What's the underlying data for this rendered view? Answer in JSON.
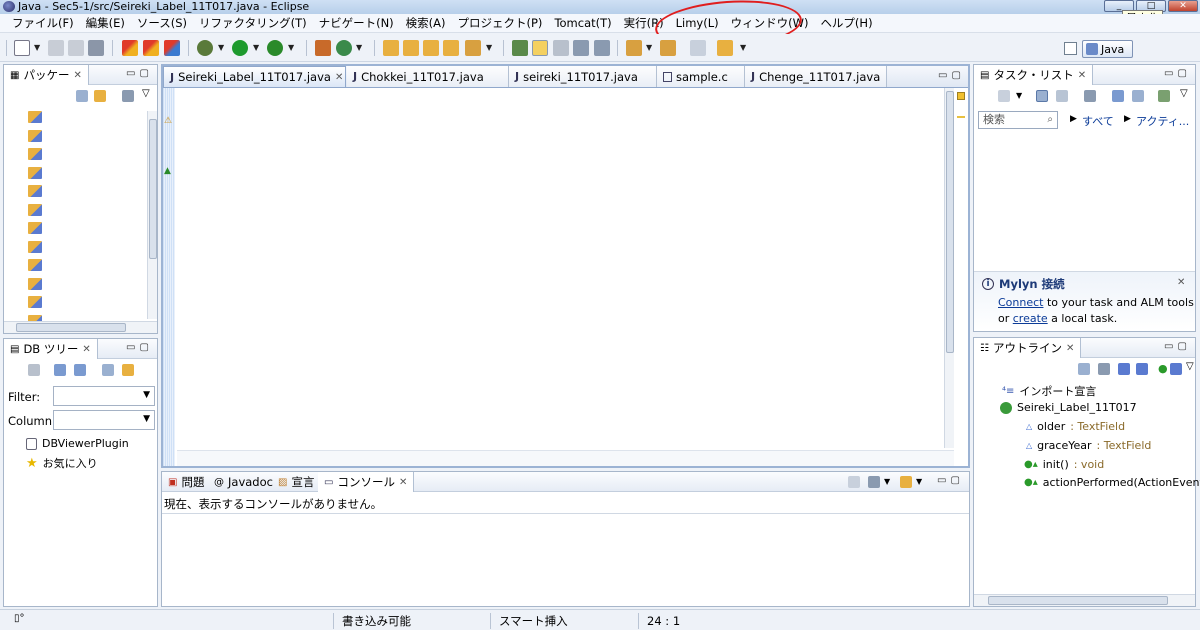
{
  "window": {
    "title": "Java - Sec5-1/src/Seireki_Label_11T017.java - Eclipse",
    "tooltip": "最小化"
  },
  "menu": [
    "ファイル(F)",
    "編集(E)",
    "ソース(S)",
    "リファクタリング(T)",
    "ナビゲート(N)",
    "検索(A)",
    "プロジェクト(P)",
    "Tomcat(T)",
    "実行(R)",
    "Limy(L)",
    "ウィンドウ(W)",
    "ヘルプ(H)"
  ],
  "perspective": {
    "label": "Java"
  },
  "package_explorer": {
    "title": "パッケー"
  },
  "db_tree": {
    "title": "DB ツリー",
    "filter_label": "Filter:",
    "column_label": "Column:",
    "items": [
      "DBViewerPlugin",
      "お気に入り"
    ]
  },
  "editor": {
    "tabs": [
      "Seireki_Label_11T017.java",
      "Chokkei_11T017.java",
      "seireki_11T017.java",
      "sample.c",
      "Chenge_11T017.java"
    ]
  },
  "console_panel": {
    "tabs": [
      "問題",
      "Javadoc",
      "宣言",
      "コンソール"
    ],
    "message": "現在、表示するコンソールがありません。"
  },
  "task_list": {
    "title": "タスク・リスト",
    "search_placeholder": "検索",
    "filter_all": "すべて",
    "filter_active": "アクティ..."
  },
  "mylyn": {
    "title": "Mylyn 接続",
    "connect_link": "Connect",
    "connect_text": " to your task and ALM tools",
    "or_text": "or ",
    "create_link": "create",
    "create_text": " a local task."
  },
  "outline": {
    "title": "アウトライン",
    "items": [
      {
        "name": "インポート宣言",
        "type": ""
      },
      {
        "name": "Seireki_Label_11T017",
        "type": ""
      },
      {
        "name": "older",
        "type": " : TextField"
      },
      {
        "name": "graceYear",
        "type": " : TextField"
      },
      {
        "name": "init()",
        "type": " : void"
      },
      {
        "name": "actionPerformed(ActionEvent",
        "type": ""
      }
    ]
  },
  "status_bar": {
    "writable": "書き込み可能",
    "insert_mode": "スマート挿入",
    "position": "24 : 1"
  },
  "colors": {
    "annotation": "#e01e1e",
    "link": "#0b3b98",
    "active_tab_border": "#90a8cc"
  }
}
